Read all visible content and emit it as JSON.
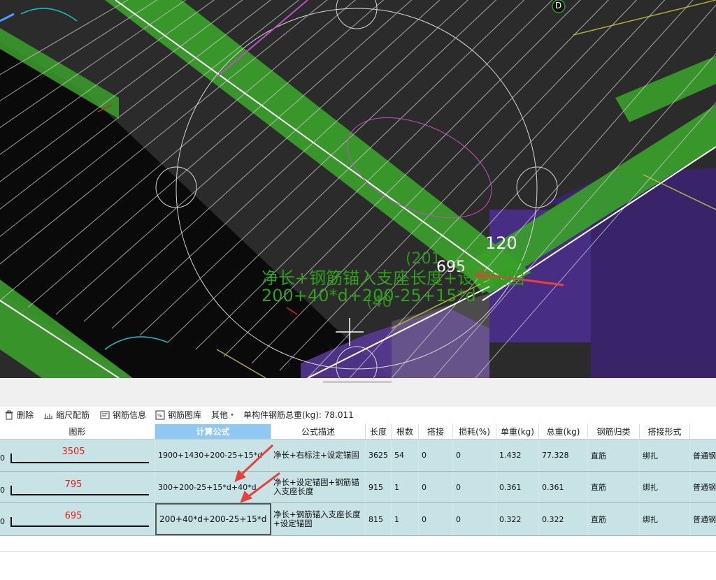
{
  "viewport": {
    "labels": {
      "axis_marker": "D",
      "dim_120": "120",
      "dim_695": "695",
      "green_line1": "净长+钢筋锚入支座长度+设定锚固",
      "green_line2": "200+40*d+200-25+15*d",
      "overlap_a": "(201",
      "overlap_b": "(40",
      "overlap_c": "1)"
    },
    "colors": {
      "background": "#2b2b2b",
      "beam_green": "#3aa02a",
      "hatch": "#cfcfcf",
      "column_purple": "#4a2d8a",
      "annotation_green": "#2ea01a",
      "arrow_red": "#e8403a"
    }
  },
  "toolbar": {
    "delete": "删除",
    "scale": "缩尺配筋",
    "info": "钢筋信息",
    "library": "钢筋图库",
    "other": "其他",
    "total_label": "单构件钢筋总重(kg): 78.011"
  },
  "table": {
    "headers": [
      "图形",
      "计算公式",
      "公式描述",
      "长度",
      "根数",
      "搭接",
      "损耗(%)",
      "单重(kg)",
      "总重(kg)",
      "钢筋归类",
      "搭接形式",
      ""
    ],
    "rows": [
      {
        "idx": "0",
        "shape": "3505",
        "formula": "1900+1430+200-25+15*d",
        "desc": "净长+右标注+设定锚固",
        "length": "3625",
        "count": "54",
        "lap": "0",
        "loss": "0",
        "unit_w": "1.432",
        "total_w": "77.328",
        "category": "直筋",
        "lap_type": "绑扎",
        "type": "普通钢"
      },
      {
        "idx": "0",
        "shape": "795",
        "formula": "300+200-25+15*d+40*d",
        "desc": "净长+设定锚固+钢筋锚入支座长度",
        "length": "915",
        "count": "1",
        "lap": "0",
        "loss": "0",
        "unit_w": "0.361",
        "total_w": "0.361",
        "category": "直筋",
        "lap_type": "绑扎",
        "type": "普通钢"
      },
      {
        "idx": "0",
        "shape": "695",
        "formula": "200+40*d+200-25+15*d",
        "desc": "净长+钢筋锚入支座长度+设定锚固",
        "length": "815",
        "count": "1",
        "lap": "0",
        "loss": "0",
        "unit_w": "0.322",
        "total_w": "0.322",
        "category": "直筋",
        "lap_type": "绑扎",
        "type": "普通钢"
      }
    ]
  }
}
